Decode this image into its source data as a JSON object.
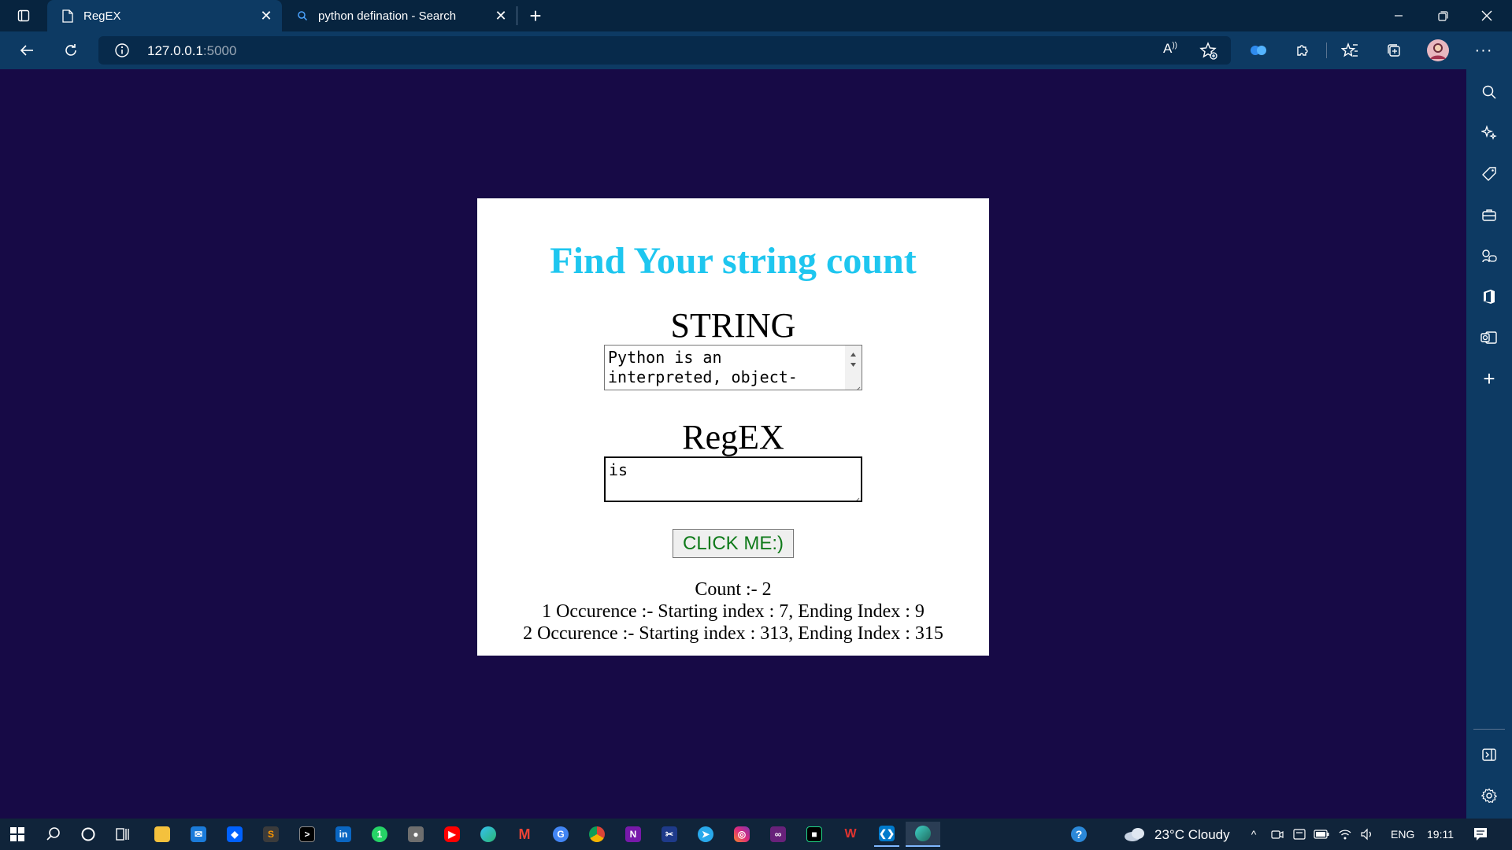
{
  "browser": {
    "tabs": [
      {
        "label": "RegEX",
        "icon": "page-icon",
        "active": true
      },
      {
        "label": "python defination - Search",
        "icon": "search-icon",
        "active": false
      }
    ],
    "url_host": "127.0.0.1",
    "url_port": ":5000",
    "read_aloud_label": "A"
  },
  "page": {
    "heading": "Find Your string count",
    "string_label": "STRING",
    "string_value": "Python is an interpreted, object-oriented, high-",
    "regex_label": "RegEX",
    "regex_value": "is",
    "button_label": "CLICK ME:)",
    "count_text": "Count :- 2",
    "occurrences": [
      "1 Occurence :- Starting index : 7, Ending Index : 9",
      "2 Occurence :- Starting index : 313, Ending Index : 315"
    ]
  },
  "taskbar": {
    "weather": "23°C  Cloudy",
    "language": "ENG",
    "time": "19:11",
    "apps": [
      "file-explorer",
      "mail",
      "dropbox",
      "sublime",
      "terminal",
      "linkedin",
      "whatsapp",
      "github",
      "youtube",
      "edge",
      "gmail",
      "chrome-canary",
      "chrome",
      "onenote",
      "snipping",
      "telegram",
      "instagram",
      "visual-studio",
      "jetbrains",
      "wps",
      "vscode",
      "edge-dev"
    ]
  },
  "colors": {
    "page_background": "#170a46",
    "heading": "#1ec6ef",
    "button_text": "#0f7a1a",
    "browser_frame": "#0d3a63"
  }
}
